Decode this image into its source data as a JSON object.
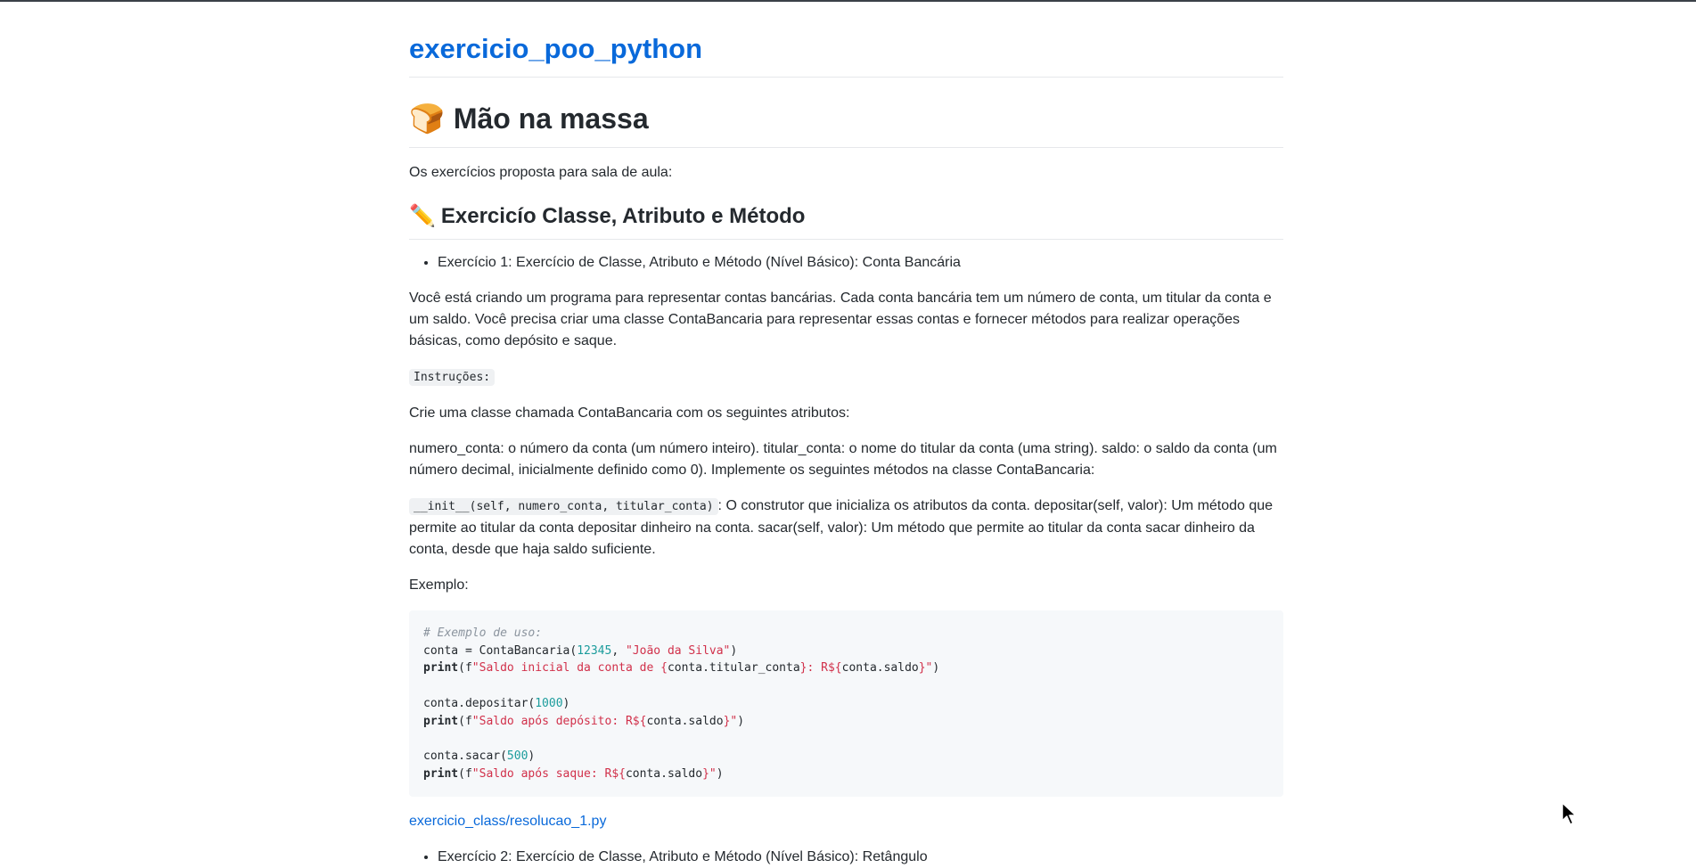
{
  "header": {
    "site_title": "exercicio_poo_python"
  },
  "section": {
    "title": "Mão na massa",
    "title_emoji": "🍞",
    "intro": "Os exercícios proposta para sala de aula:",
    "subsection_emoji": "✏️",
    "subsection_title": "Exercicío Classe, Atributo e Método"
  },
  "exercise1": {
    "bullet": "Exercício 1: Exercício de Classe, Atributo e Método (Nível Básico): Conta Bancária",
    "description": "Você está criando um programa para representar contas bancárias. Cada conta bancária tem um número de conta, um titular da conta e um saldo. Você precisa criar uma classe ContaBancaria para representar essas contas e fornecer métodos para realizar operações básicas, como depósito e saque.",
    "instructions_label": "Instruções:",
    "create_class": "Crie uma classe chamada ContaBancaria com os seguintes atributos:",
    "attributes": "numero_conta: o número da conta (um número inteiro). titular_conta: o nome do titular da conta (uma string). saldo: o saldo da conta (um número decimal, inicialmente definido como 0). Implemente os seguintes métodos na classe ContaBancaria:",
    "methods_code": "__init__(self, numero_conta, titular_conta)",
    "methods_text": ": O construtor que inicializa os atributos da conta. depositar(self, valor): Um método que permite ao titular da conta depositar dinheiro na conta. sacar(self, valor): Um método que permite ao titular da conta sacar dinheiro da conta, desde que haja saldo suficiente.",
    "example_label": "Exemplo:",
    "code": {
      "comment": "# Exemplo de uso:",
      "l2_a": "conta = ContaBancaria(",
      "l2_num": "12345",
      "l2_b": ", ",
      "l2_str": "\"João da Silva\"",
      "l2_c": ")",
      "print_kw": "print",
      "l3_a": "(f",
      "l3_s1": "\"Saldo inicial da conta de {",
      "l3_v1": "conta.titular_conta",
      "l3_s2": "}: R${",
      "l3_v2": "conta.saldo",
      "l3_s3": "}\"",
      "l3_c": ")",
      "l5_a": "conta.depositar(",
      "l5_num": "1000",
      "l5_c": ")",
      "l6_s1": "\"Saldo após depósito: R${",
      "l6_v": "conta.saldo",
      "l6_s2": "}\"",
      "l8_a": "conta.sacar(",
      "l8_num": "500",
      "l8_c": ")",
      "l9_s1": "\"Saldo após saque: R${",
      "l9_v": "conta.saldo",
      "l9_s2": "}\""
    },
    "solution_link": "exercicio_class/resolucao_1.py"
  },
  "exercise2": {
    "bullet": "Exercício 2: Exercício de Classe, Atributo e Método (Nível Básico): Retângulo"
  },
  "icons": {
    "cursor": "mouse-pointer-icon"
  }
}
